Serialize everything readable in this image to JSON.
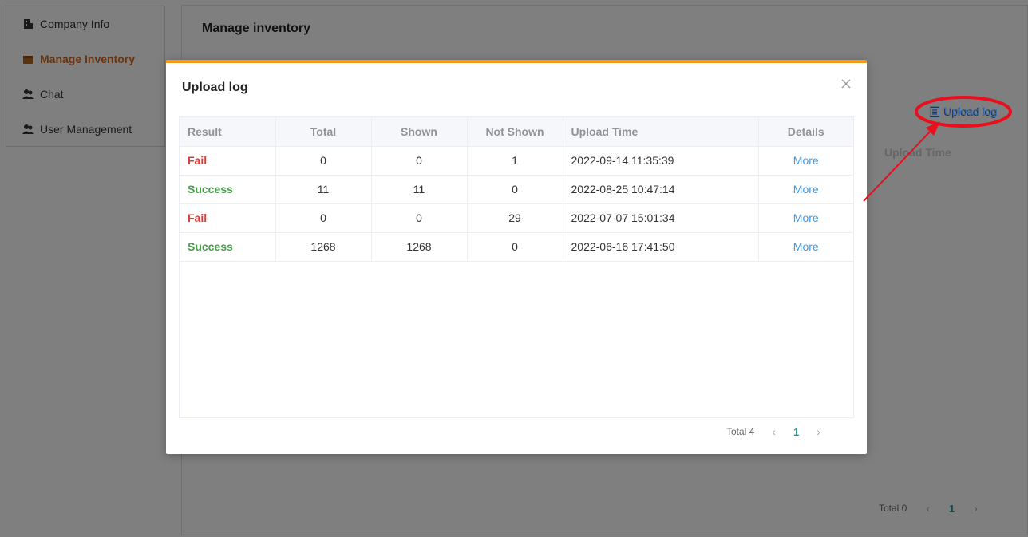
{
  "sidebar": {
    "items": [
      {
        "label": "Company Info",
        "icon": "building-icon",
        "active": false
      },
      {
        "label": "Manage Inventory",
        "icon": "box-icon",
        "active": true
      },
      {
        "label": "Chat",
        "icon": "users-icon",
        "active": false
      },
      {
        "label": "User Management",
        "icon": "users-icon",
        "active": false
      }
    ]
  },
  "main": {
    "title": "Manage inventory",
    "upload_log_label": "Upload log",
    "column_header_partial": "Upload Time",
    "pagination": {
      "total": "Total 0",
      "current_page": "1"
    }
  },
  "modal": {
    "title": "Upload log",
    "columns": [
      "Result",
      "Total",
      "Shown",
      "Not Shown",
      "Upload Time",
      "Details"
    ],
    "rows": [
      {
        "result": "Fail",
        "status": "fail",
        "total": "0",
        "shown": "0",
        "not_shown": "1",
        "upload_time": "2022-09-14 11:35:39",
        "details": "More"
      },
      {
        "result": "Success",
        "status": "success",
        "total": "11",
        "shown": "11",
        "not_shown": "0",
        "upload_time": "2022-08-25 10:47:14",
        "details": "More"
      },
      {
        "result": "Fail",
        "status": "fail",
        "total": "0",
        "shown": "0",
        "not_shown": "29",
        "upload_time": "2022-07-07 15:01:34",
        "details": "More"
      },
      {
        "result": "Success",
        "status": "success",
        "total": "1268",
        "shown": "1268",
        "not_shown": "0",
        "upload_time": "2022-06-16 17:41:50",
        "details": "More"
      }
    ],
    "pagination": {
      "total": "Total 4",
      "current_page": "1"
    }
  },
  "annotation": {
    "label": "Upload log",
    "color": "#e8101e"
  },
  "colors": {
    "accent": "#f39a1e",
    "active_nav": "#d2691e",
    "fail": "#e53935",
    "success": "#43a047",
    "link": "#3d9be9",
    "page_active": "#14a39a"
  }
}
